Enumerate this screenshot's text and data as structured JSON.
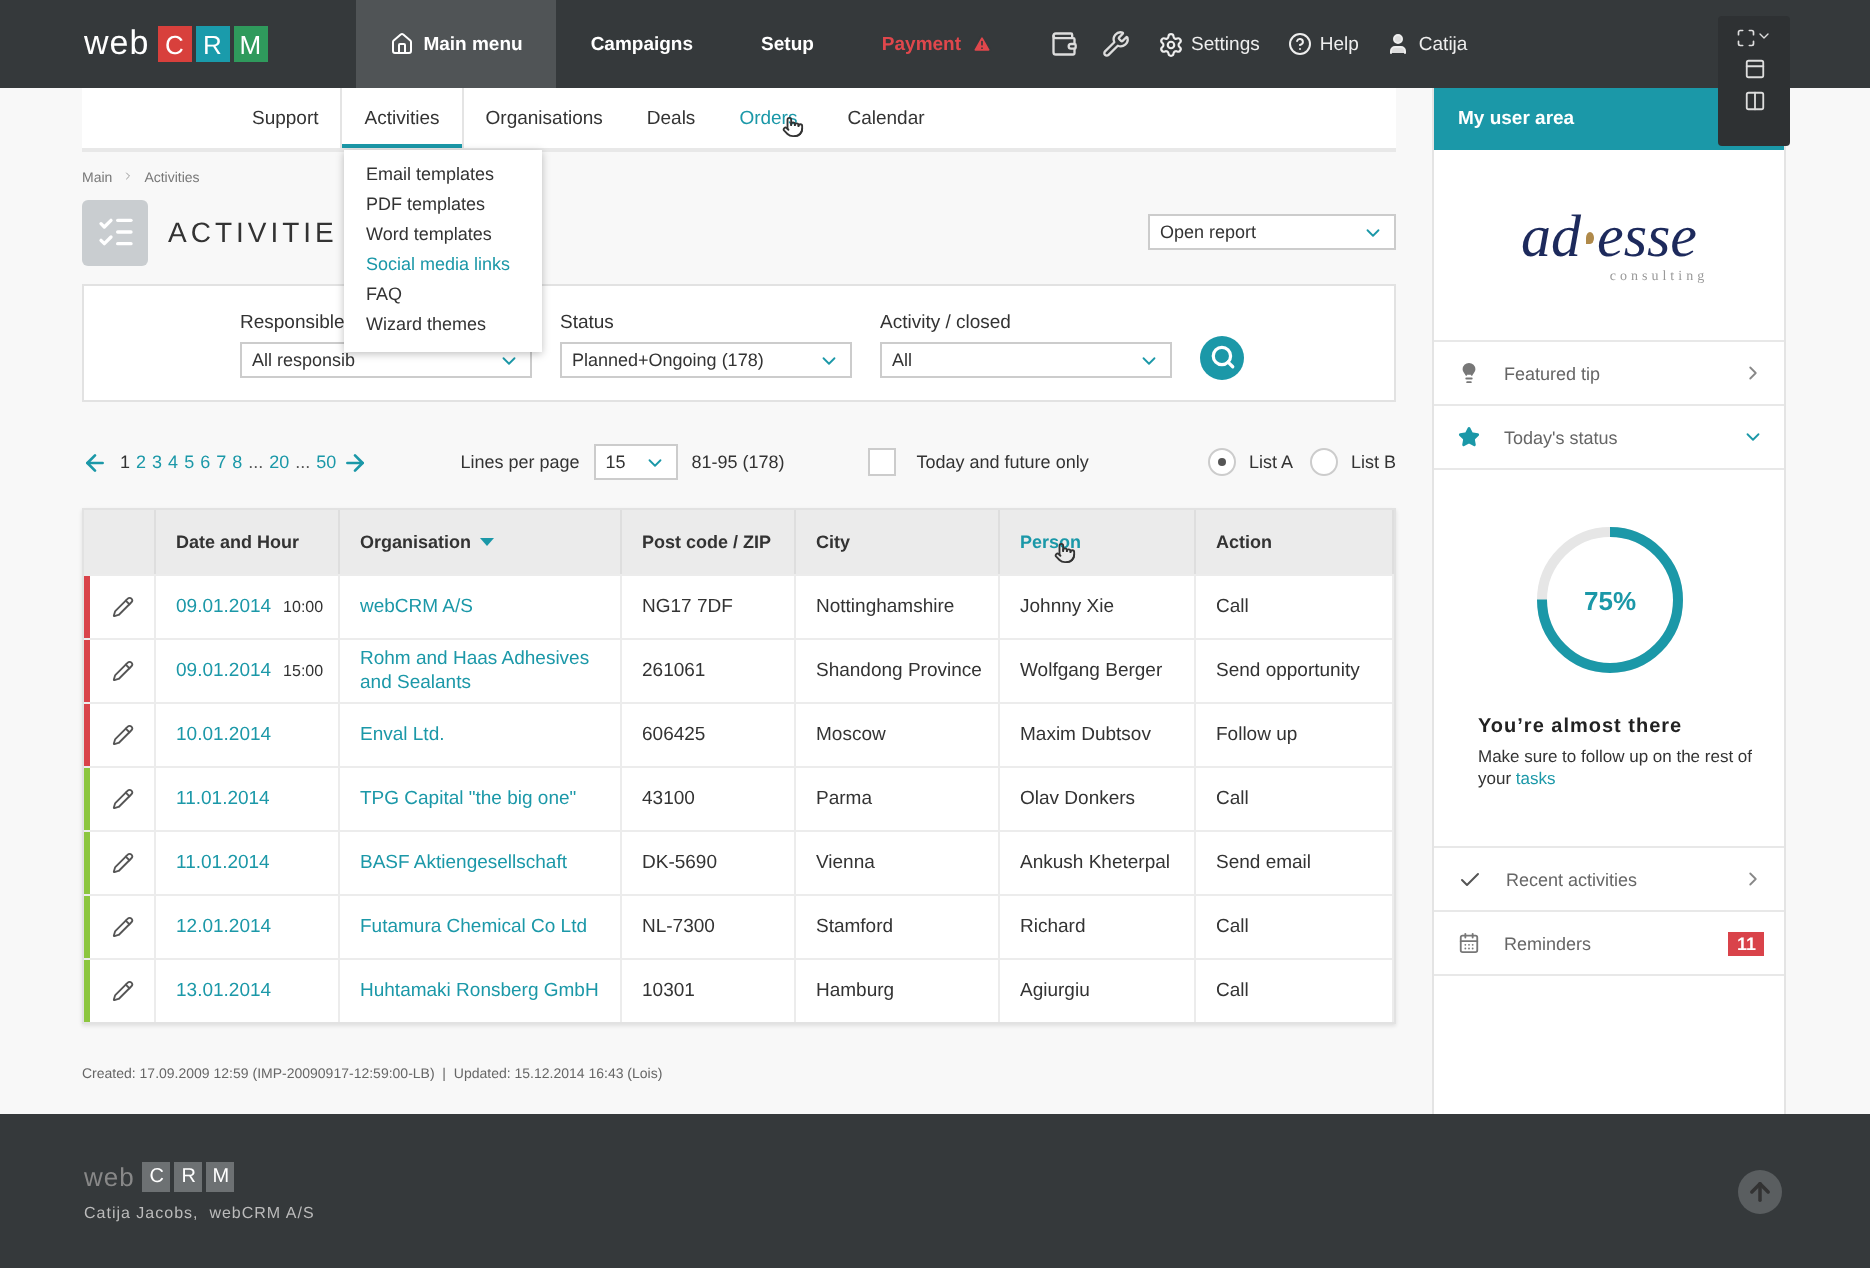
{
  "header": {
    "logo": {
      "prefix": "web",
      "letters": [
        {
          "char": "C",
          "color": "#d8403c"
        },
        {
          "char": "R",
          "color": "#1a9bab"
        },
        {
          "char": "M",
          "color": "#2f9a5c"
        }
      ]
    },
    "menu": [
      {
        "label": "Main menu",
        "kind": "home",
        "selected": true
      },
      {
        "label": "Campaigns",
        "kind": "plain",
        "selected": false
      },
      {
        "label": "Setup",
        "kind": "plain",
        "selected": false
      },
      {
        "label": "Payment",
        "kind": "alert",
        "selected": false
      }
    ],
    "tools": [
      {
        "kind": "wallet"
      },
      {
        "kind": "tools"
      }
    ],
    "links": [
      {
        "label": "Settings",
        "kind": "settings"
      },
      {
        "label": "Help",
        "kind": "help"
      },
      {
        "label": "Catija",
        "kind": "user"
      }
    ]
  },
  "subnav": [
    {
      "label": "Support",
      "selected": false
    },
    {
      "label": "Activities",
      "selected": true
    },
    {
      "label": "Organisations",
      "selected": false
    },
    {
      "label": "Deals",
      "selected": false
    },
    {
      "label": "Orders",
      "selected": false,
      "hover": true
    },
    {
      "label": "Calendar",
      "selected": false
    }
  ],
  "dropdown": [
    {
      "label": "Email templates",
      "hover": false
    },
    {
      "label": "PDF templates",
      "hover": false
    },
    {
      "label": "Word templates",
      "hover": false
    },
    {
      "label": "Social media links",
      "hover": true
    },
    {
      "label": "FAQ",
      "hover": false
    },
    {
      "label": "Wizard themes",
      "hover": false
    }
  ],
  "breadcrumb": [
    "Main",
    "Activities"
  ],
  "title": "ACTIVITIE",
  "report_select": "Open report",
  "filters": [
    {
      "label": "Responsible",
      "value": "All responsib"
    },
    {
      "label": "Status",
      "value": "Planned+Ongoing (178)"
    },
    {
      "label": "Activity / closed",
      "value": "All"
    }
  ],
  "pager": {
    "pages": [
      {
        "label": "1",
        "selected": true
      },
      {
        "label": "2",
        "selected": false
      },
      {
        "label": "3",
        "selected": false
      },
      {
        "label": "4",
        "selected": false
      },
      {
        "label": "5",
        "selected": false
      },
      {
        "label": "6",
        "selected": false
      },
      {
        "label": "7",
        "selected": false
      },
      {
        "label": "8",
        "selected": false
      },
      {
        "label": "...",
        "kind": "gap"
      },
      {
        "label": "20",
        "selected": false
      },
      {
        "label": "...",
        "kind": "gap"
      },
      {
        "label": "50",
        "selected": false
      }
    ],
    "lines_label": "Lines per page",
    "lines_value": "15",
    "range": "81-95 (178)",
    "future_only": {
      "label": "Today and future only",
      "checked": false
    },
    "lists": [
      {
        "label": "List A",
        "selected": true
      },
      {
        "label": "List B",
        "selected": false
      }
    ]
  },
  "table": {
    "columns": [
      {
        "label": "Date and Hour",
        "sorted": false,
        "hover": false
      },
      {
        "label": "Organisation",
        "sorted": true,
        "hover": false
      },
      {
        "label": "Post code / ZIP",
        "sorted": false,
        "hover": false
      },
      {
        "label": "City",
        "sorted": false,
        "hover": false
      },
      {
        "label": "Person",
        "sorted": false,
        "hover": true
      },
      {
        "label": "Action",
        "sorted": false,
        "hover": false
      }
    ],
    "rows": [
      {
        "color": "#d9434a",
        "date": "09.01.2014",
        "time": "10:00",
        "organisation": "webCRM A/S",
        "zip": "NG17 7DF",
        "city": "Nottinghamshire",
        "person": "Johnny Xie",
        "action": "Call"
      },
      {
        "color": "#d9434a",
        "date": "09.01.2014",
        "time": "15:00",
        "organisation": "Rohm and Haas Adhesives and Sealants",
        "zip": "261061",
        "city": "Shandong Province",
        "person": "Wolfgang Berger",
        "action": "Send opportunity"
      },
      {
        "color": "#d9434a",
        "date": "10.01.2014",
        "organisation": "Enval Ltd.",
        "zip": "606425",
        "city": "Moscow",
        "person": "Maxim Dubtsov",
        "action": "Follow up"
      },
      {
        "color": "#8cc63f",
        "date": "11.01.2014",
        "organisation": "TPG Capital \"the big one\"",
        "zip": "43100",
        "city": "Parma",
        "person": "Olav Donkers",
        "action": "Call"
      },
      {
        "color": "#8cc63f",
        "date": "11.01.2014",
        "organisation": "BASF Aktiengesellschaft",
        "zip": "DK-5690",
        "city": "Vienna",
        "person": "Ankush Kheterpal",
        "action": "Send email"
      },
      {
        "color": "#8cc63f",
        "date": "12.01.2014",
        "organisation": "Futamura Chemical Co Ltd",
        "zip": "NL-7300",
        "city": "Stamford",
        "person": "Richard",
        "action": "Call"
      },
      {
        "color": "#8cc63f",
        "date": "13.01.2014",
        "organisation": "Huhtamaki Ronsberg GmbH",
        "zip": "10301",
        "city": "Hamburg",
        "person": "Agiurgiu",
        "action": "Call"
      }
    ]
  },
  "record_info": "Created: 17.09.2009 12:59 (IMP-20090917-12:59:00-LB)  |  Updated: 15.12.2014 16:43 (Lois)",
  "sidebar": {
    "title": "My user area",
    "company_logo": {
      "name": "ad",
      "name_end": "esse",
      "tagline": "consulting"
    },
    "sections": [
      {
        "label": "Featured tip",
        "kind": "tip",
        "expanded": false
      },
      {
        "label": "Today's status",
        "kind": "status",
        "expanded": true
      }
    ],
    "status": {
      "level": 0.75,
      "reading": "75%",
      "heading": "You’re almost there",
      "text": "Make sure to follow up on the rest of your",
      "link": "tasks"
    },
    "bottom": [
      {
        "label": "Recent activities",
        "kind": "recent"
      },
      {
        "label": "Reminders",
        "kind": "reminders",
        "badge": "11"
      }
    ]
  },
  "footer": {
    "logo": {
      "prefix": "web",
      "letters": [
        "C",
        "R",
        "M"
      ]
    },
    "owner": "Catija Jacobs,",
    "company": "webCRM A/S"
  }
}
